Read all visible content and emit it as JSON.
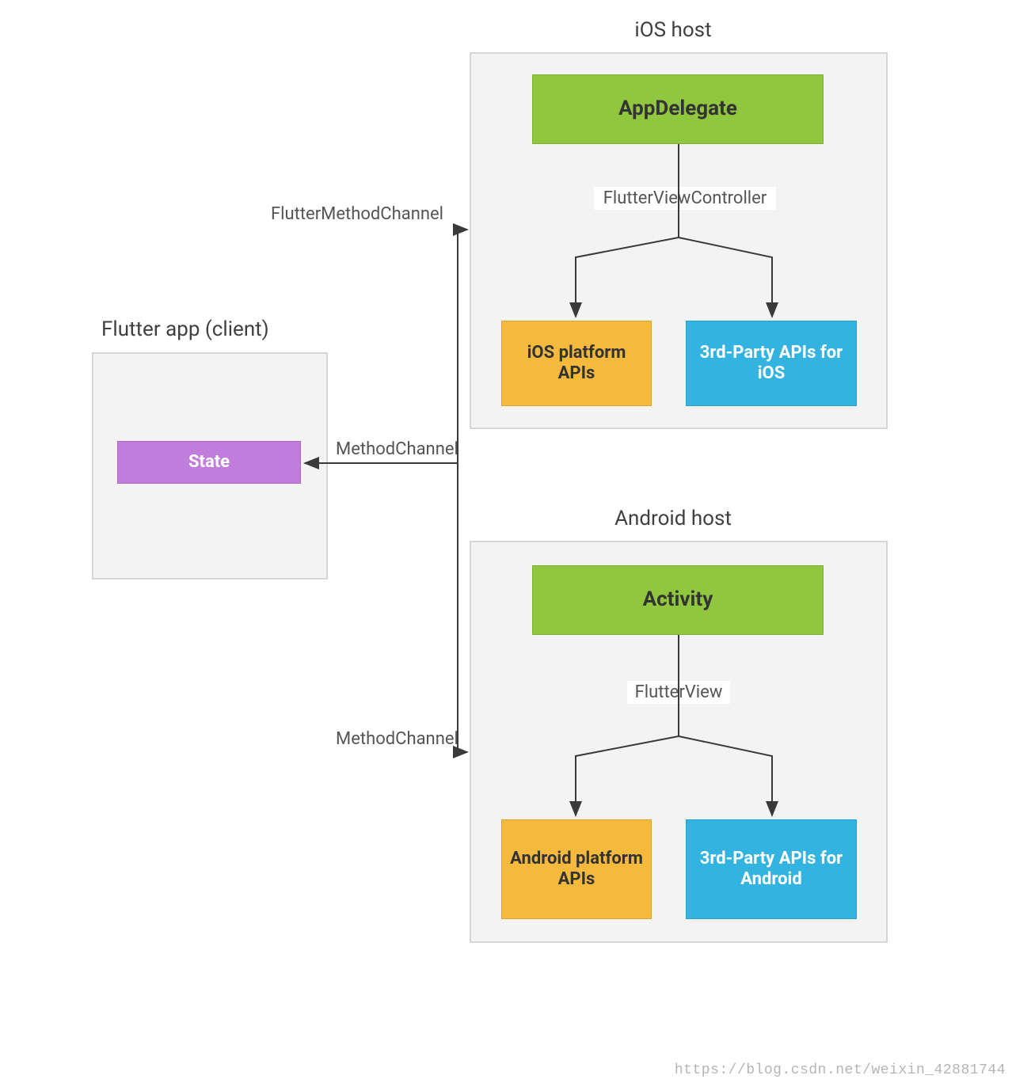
{
  "client": {
    "title": "Flutter app (client)",
    "state_label": "State"
  },
  "ios": {
    "title": "iOS host",
    "app_delegate": "AppDelegate",
    "fvc_label": "FlutterViewController",
    "platform_apis": "iOS platform APIs",
    "third_party": "3rd-Party APIs for iOS"
  },
  "android": {
    "title": "Android host",
    "activity": "Activity",
    "fv_label": "FlutterView",
    "platform_apis": "Android platform APIs",
    "third_party": "3rd-Party APIs for Android"
  },
  "connectors": {
    "flutter_method_channel": "FlutterMethodChannel",
    "method_channel": "MethodChannel",
    "method_channel_android": "MethodChannel"
  },
  "watermark": "https://blog.csdn.net/weixin_42881744"
}
